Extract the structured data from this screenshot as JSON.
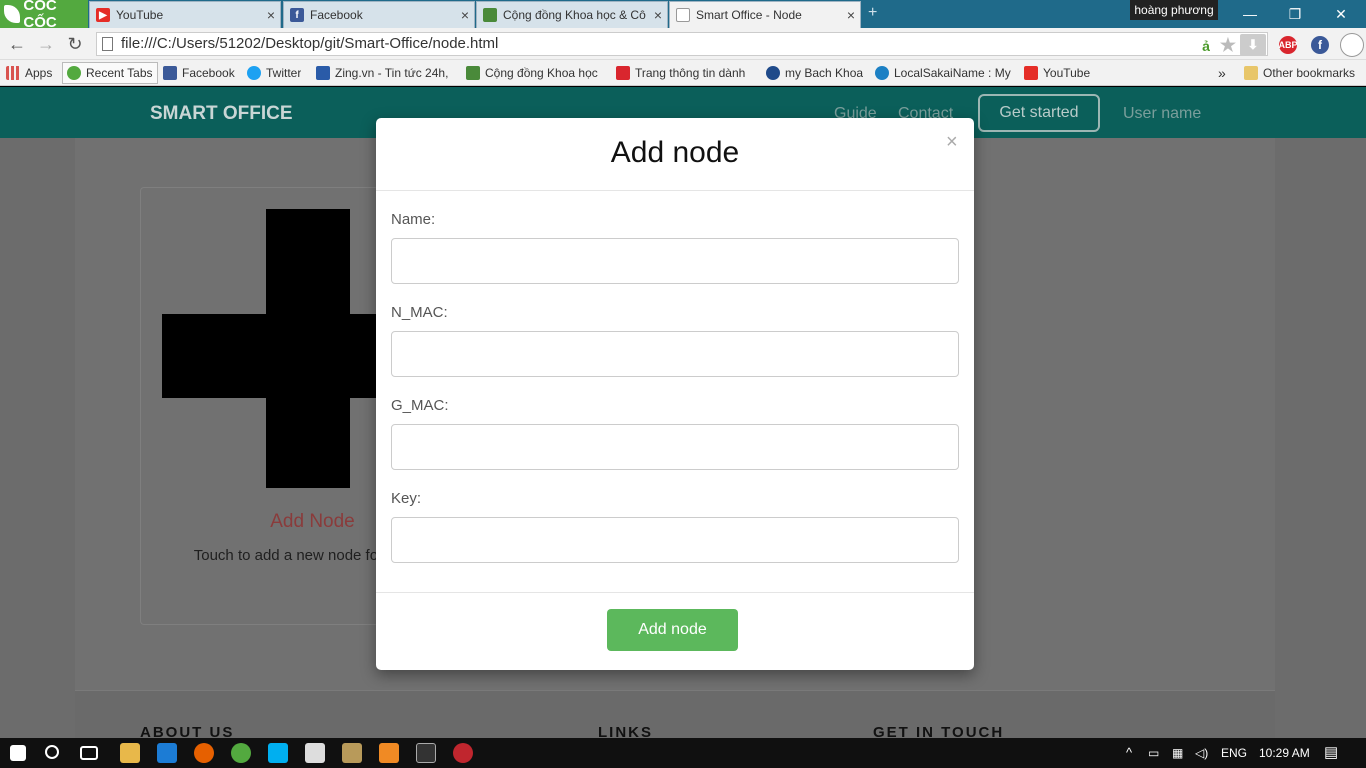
{
  "browser": {
    "logo": "CỐC CỐC",
    "tabs": [
      {
        "title": "YouTube",
        "icon_color": "#e52d27"
      },
      {
        "title": "Facebook",
        "icon_color": "#3b5998"
      },
      {
        "title": "Cộng đồng Khoa học & Cô",
        "icon_color": "#4a8a3a"
      },
      {
        "title": "Smart Office - Node",
        "icon_color": "#ffffff"
      }
    ],
    "user": "hoàng phương",
    "url": "file:///C:/Users/51202/Desktop/git/Smart-Office/node.html",
    "bookmarks": [
      {
        "label": "Apps",
        "icon_color": "#d9534f"
      },
      {
        "label": "Recent Tabs",
        "icon_color": "#53a93f"
      },
      {
        "label": "Facebook",
        "icon_color": "#3b5998"
      },
      {
        "label": "Twitter",
        "icon_color": "#1da1f2"
      },
      {
        "label": "Zing.vn - Tin tức 24h,",
        "icon_color": "#2a5ba8"
      },
      {
        "label": "Cộng đồng Khoa học",
        "icon_color": "#4a8a3a"
      },
      {
        "label": "Trang thông tin dành",
        "icon_color": "#d9262e"
      },
      {
        "label": "my Bach Khoa",
        "icon_color": "#1f4a8a"
      },
      {
        "label": "LocalSakaiName : My",
        "icon_color": "#1c80c4"
      },
      {
        "label": "YouTube",
        "icon_color": "#e52d27"
      }
    ],
    "more_bookmarks": "»",
    "other_bookmarks": "Other bookmarks",
    "ext_abp": "ABP",
    "ext_fb": "f"
  },
  "site": {
    "brand": "SMART OFFICE",
    "nav": {
      "guide": "Guide",
      "contact": "Contact",
      "get_started": "Get started",
      "user_name": "User name"
    },
    "card": {
      "title": "Add Node",
      "description": "Touch to add a new node for control"
    },
    "footer": {
      "about": "ABOUT US",
      "links": "LINKS",
      "contact": "GET IN TOUCH"
    }
  },
  "modal": {
    "title": "Add node",
    "close": "×",
    "fields": [
      {
        "label": "Name:",
        "value": ""
      },
      {
        "label": "N_MAC:",
        "value": ""
      },
      {
        "label": "G_MAC:",
        "value": ""
      },
      {
        "label": "Key:",
        "value": ""
      }
    ],
    "submit": "Add node"
  },
  "taskbar": {
    "language": "ENG",
    "time": "10:29 AM"
  },
  "colors": {
    "primary": "#0b5f5a",
    "success": "#5cb85c",
    "card_title": "#8a3b3b"
  }
}
